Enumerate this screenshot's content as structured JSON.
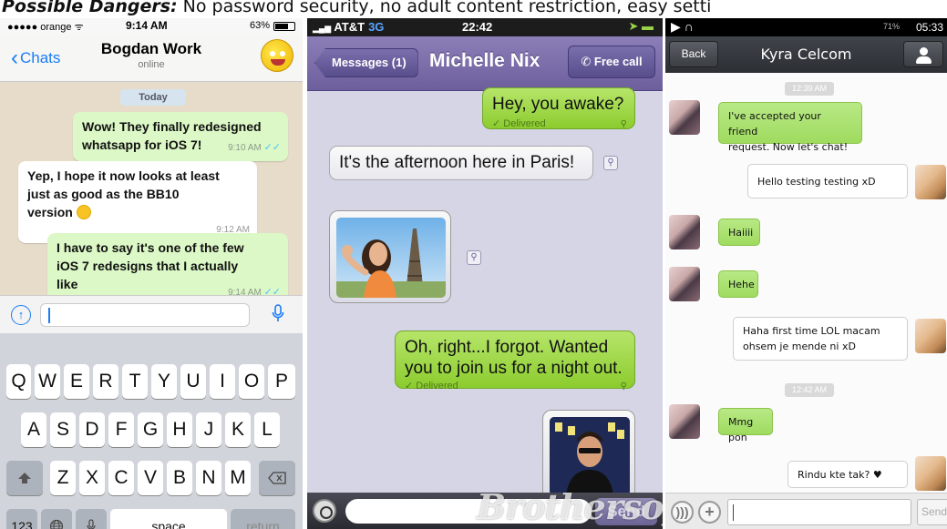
{
  "banner": {
    "bold": "Possible Dangers:",
    "rest": " No password security, no adult content restriction, easy setti"
  },
  "whatsapp": {
    "status": {
      "carrier": "●●●●● orange ᯤ",
      "time": "9:14 AM",
      "battery": "63%"
    },
    "nav": {
      "back": "Chats",
      "title": "Bogdan Work",
      "subtitle": "online"
    },
    "date_label": "Today",
    "messages": [
      {
        "dir": "out",
        "lines": [
          "Wow! They finally redesigned",
          "whatsapp for iOS 7!"
        ],
        "time": "9:10 AM"
      },
      {
        "dir": "in",
        "lines": [
          "Yep, I hope it now looks at least",
          "just as good as the BB10",
          "version"
        ],
        "time": "9:12 AM"
      },
      {
        "dir": "out",
        "lines": [
          "I have to say it's one of the few",
          "iOS 7 redesigns that I actually",
          "like"
        ],
        "time": "9:14 AM"
      }
    ],
    "keyboard": {
      "row1": [
        "Q",
        "W",
        "E",
        "R",
        "T",
        "Y",
        "U",
        "I",
        "O",
        "P"
      ],
      "row2": [
        "A",
        "S",
        "D",
        "F",
        "G",
        "H",
        "J",
        "K",
        "L"
      ],
      "row3": [
        "Z",
        "X",
        "C",
        "V",
        "B",
        "N",
        "M"
      ],
      "num": "123",
      "space": "space",
      "return": "return"
    }
  },
  "viber": {
    "status": {
      "carrier": "AT&T",
      "network": "3G",
      "time": "22:42"
    },
    "nav": {
      "back": "Messages (1)",
      "title": "Michelle Nix",
      "call": "Free call"
    },
    "messages": [
      {
        "dir": "out",
        "text": "Hey, you awake?",
        "status": "Delivered"
      },
      {
        "dir": "in",
        "text": "It's the afternoon here in Paris!"
      },
      {
        "dir": "out",
        "text": "Oh, right...I forgot. Wanted you to join us for a night out.",
        "status": "Delivered"
      }
    ],
    "send": "Send",
    "watermark": "Brothersoft"
  },
  "wechat": {
    "status": {
      "time": "05:33",
      "battery": "71%"
    },
    "nav": {
      "back": "Back",
      "title": "Kyra Celcom"
    },
    "timestamps": [
      "12:39 AM",
      "12:42 AM"
    ],
    "messages": [
      {
        "dir": "in",
        "lines": [
          "I've accepted your friend",
          "request. Now let's chat!"
        ]
      },
      {
        "dir": "out",
        "lines": [
          "Hello testing testing xD"
        ]
      },
      {
        "dir": "in",
        "lines": [
          "Haiiii"
        ]
      },
      {
        "dir": "in",
        "lines": [
          "Hehe"
        ]
      },
      {
        "dir": "out",
        "lines": [
          "Haha first time LOL macam",
          "ohsem je mende ni xD"
        ]
      },
      {
        "dir": "in",
        "lines": [
          "Mmg pon"
        ]
      },
      {
        "dir": "out",
        "lines": [
          "Rindu kte tak? ♥"
        ]
      }
    ],
    "send": "Send"
  }
}
